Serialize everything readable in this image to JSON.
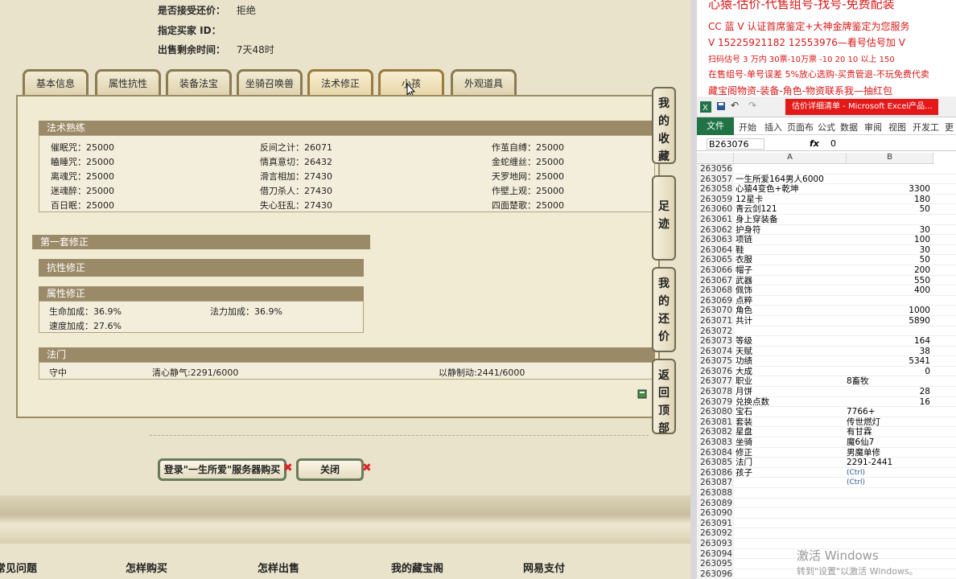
{
  "info": {
    "accept_counter_label": "是否接受还价：",
    "accept_counter_value": "拒绝",
    "buyer_id_label": "指定买家 ID：",
    "time_left_label": "出售剩余时间：",
    "time_left_value": "7天48时"
  },
  "tabs": [
    "基本信息",
    "属性抗性",
    "装备法宝",
    "坐骑召唤兽",
    "法术修正",
    "小孩",
    "外观道具"
  ],
  "spell_skill": {
    "title": "法术熟练",
    "rows": [
      [
        "催眠咒：25000",
        "反间之计：26071",
        "作茧自缚：25000"
      ],
      [
        "瞌睡咒：25000",
        "情真意切：26432",
        "金蛇缠丝：25000"
      ],
      [
        "离魂咒：25000",
        "滑言相加：27430",
        "天罗地网：25000"
      ],
      [
        "迷魂醉：25000",
        "借刀杀人：27430",
        "作壁上观：25000"
      ],
      [
        "百日眠：25000",
        "失心狂乱：27430",
        "四面楚歌：25000"
      ]
    ]
  },
  "first_mod": {
    "title": "第一套修正"
  },
  "resist_mod": {
    "title": "抗性修正"
  },
  "attr_mod": {
    "title": "属性修正",
    "hp": "生命加成：36.9%",
    "mp": "法力加成：36.9%",
    "speed": "速度加成：27.6%"
  },
  "school": {
    "title": "法门",
    "a": "守中",
    "b": "清心静气:2291/6000",
    "c": "以静制动:2441/6000"
  },
  "side_buttons": [
    "我的收藏",
    "足迹",
    "我的还价",
    "返回顶部"
  ],
  "buttons": {
    "login_buy": "登录\"一生所爱\"服务器购买",
    "close": "关闭"
  },
  "footer_nav": [
    "常见问题",
    "怎样购买",
    "怎样出售",
    "我的藏宝阁",
    "网易支付"
  ],
  "ads": [
    "心猿-估价-代售组号-找号-免费配装",
    "CC 蓝 V 认证首席鉴定+大神金牌鉴定为您服务",
    "V 15225921182        12553976—看号估号加 V",
    "扫码估号 3 万内 30票-10万票 -10 20 10 以上 150",
    "在售组号-单号误差 5%放心选购-买贵管退-不玩免费代卖",
    "藏宝阁物资-装备-角色-物资联系我—抽红包"
  ],
  "excel": {
    "title": "估价详细清单 - Microsoft Excel产品...",
    "ribbon": [
      "文件",
      "开始",
      "插入",
      "页面布",
      "公式",
      "数据",
      "审阅",
      "视图",
      "开发工",
      "更"
    ],
    "name_box": "B263076",
    "fx": "fx",
    "formula": "0",
    "col_a": "A",
    "col_b": "B",
    "rows": [
      [
        "263056",
        "",
        ""
      ],
      [
        "263057",
        "一生所爱164男人6000",
        ""
      ],
      [
        "263058",
        "心猿4变色+乾坤",
        "3300"
      ],
      [
        "263059",
        "12星卡",
        "180"
      ],
      [
        "263060",
        "青云剑121",
        "50"
      ],
      [
        "263061",
        "身上穿装备",
        ""
      ],
      [
        "263062",
        "护身符",
        "30"
      ],
      [
        "263063",
        "项链",
        "100"
      ],
      [
        "263064",
        "鞋",
        "30"
      ],
      [
        "263065",
        "衣服",
        "50"
      ],
      [
        "263066",
        "帽子",
        "200"
      ],
      [
        "263067",
        "武器",
        "550"
      ],
      [
        "263068",
        "佩饰",
        "400"
      ],
      [
        "263069",
        "点粹",
        ""
      ],
      [
        "263070",
        "角色",
        "1000"
      ],
      [
        "263071",
        "共计",
        "5890"
      ],
      [
        "263072",
        "",
        ""
      ],
      [
        "263073",
        "等级",
        "164"
      ],
      [
        "263074",
        "天赋",
        "38"
      ],
      [
        "263075",
        "功绩",
        "5341"
      ],
      [
        "263076",
        "大成",
        "0"
      ],
      [
        "263077",
        "职业",
        "8畜牧"
      ],
      [
        "263078",
        "月饼",
        "28"
      ],
      [
        "263079",
        "兑换点数",
        "16"
      ],
      [
        "263080",
        "宝石",
        "7766+"
      ],
      [
        "263081",
        "套装",
        "传世燃灯"
      ],
      [
        "263082",
        "星盘",
        "有甘霖"
      ],
      [
        "263083",
        "坐骑",
        "魔6仙7"
      ],
      [
        "263084",
        "修正",
        "男魔单修"
      ],
      [
        "263085",
        "法门",
        "2291-2441"
      ],
      [
        "263086",
        "孩子",
        "(Ctrl)"
      ],
      [
        "263087",
        "",
        "(Ctrl)"
      ],
      [
        "263088",
        "",
        ""
      ],
      [
        "263089",
        "",
        ""
      ],
      [
        "263090",
        "",
        ""
      ],
      [
        "263091",
        "",
        ""
      ],
      [
        "263092",
        "",
        ""
      ],
      [
        "263093",
        "",
        ""
      ],
      [
        "263094",
        "",
        ""
      ],
      [
        "263095",
        "",
        ""
      ],
      [
        "263096",
        "",
        ""
      ]
    ],
    "watermark": "激活 Windows",
    "watermark_sub": "转到\"设置\"以激活 Windows。"
  }
}
